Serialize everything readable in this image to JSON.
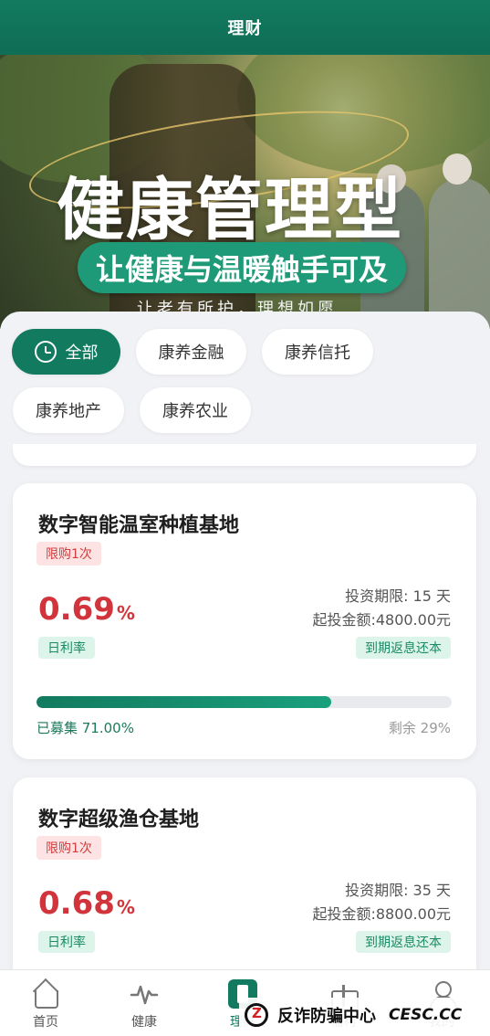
{
  "header": {
    "title": "理财"
  },
  "banner": {
    "headline": "健康管理型",
    "slogan": "让健康与温暖触手可及",
    "tagline": "让老有所护，理想如愿"
  },
  "filters": {
    "items": [
      {
        "label": "全部",
        "active": true,
        "icon": "clock-icon"
      },
      {
        "label": "康养金融",
        "active": false
      },
      {
        "label": "康养信托",
        "active": false
      },
      {
        "label": "康养地产",
        "active": false
      },
      {
        "label": "康养农业",
        "active": false
      }
    ]
  },
  "products": [
    {
      "name": "数字智能温室种植基地",
      "limit": "限购1次",
      "rate_value": "0.69",
      "rate_unit": "%",
      "rate_label": "日利率",
      "term": "投资期限: 15 天",
      "min_invest": "起投金额:4800.00元",
      "repay": "到期返息还本",
      "progress": 71,
      "raised_text": "已募集 71.00%",
      "remain_text": "剩余 29%"
    },
    {
      "name": "数字超级渔仓基地",
      "limit": "限购1次",
      "rate_value": "0.68",
      "rate_unit": "%",
      "rate_label": "日利率",
      "term": "投资期限: 35 天",
      "min_invest": "起投金额:8800.00元",
      "repay": "到期返息还本"
    }
  ],
  "tabbar": {
    "items": [
      {
        "label": "首页",
        "icon": "home-icon"
      },
      {
        "label": "健康",
        "icon": "pulse-icon"
      },
      {
        "label": "理财",
        "icon": "finance-icon",
        "active": true
      },
      {
        "label": "福利",
        "icon": "gift-icon"
      },
      {
        "label": "我的",
        "icon": "user-icon"
      }
    ]
  },
  "watermark": {
    "text": "反诈防骗中心",
    "site": "CESC.CC"
  },
  "colors": {
    "primary": "#127a5f",
    "rate_red": "#d1343a"
  }
}
